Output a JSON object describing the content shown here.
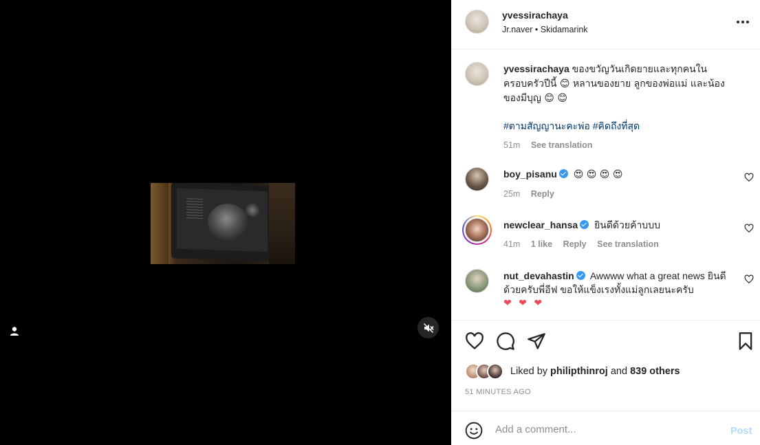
{
  "post": {
    "username": "yvessirachaya",
    "audio_line": "Jr.naver • Skidamarink",
    "caption_user": "yvessirachaya",
    "caption_text": "ของขวัญวันเกิดยายและทุกคนในครอบครัวปีนี้ 😊 หลานของยาย ลูกของพ่อแม่ และน้องของมีบุญ 😊 😊",
    "caption_tags": "#ตามสัญญานะคะพ่อ #คิดถึงที่สุด",
    "caption_time": "51m",
    "see_translation": "See translation"
  },
  "comments": [
    {
      "user": "boy_pisanu",
      "verified": true,
      "text": "😍 😍 😍 😍",
      "time": "25m",
      "likes": "",
      "reply": "Reply",
      "translate": ""
    },
    {
      "user": "newclear_hansa",
      "verified": true,
      "text": "ยินดีด้วยค้าบบบ",
      "time": "41m",
      "likes": "1 like",
      "reply": "Reply",
      "translate": "See translation"
    },
    {
      "user": "nut_devahastin",
      "verified": true,
      "text": "Awwww what a great news ยินดีด้วยครับพี่อีฟ ขอให้แข็งเรงทั้งแม่ลูกเลยนะครับ",
      "hearts": "❤ ❤ ❤",
      "time": "",
      "likes": "",
      "reply": "",
      "translate": ""
    }
  ],
  "likes": {
    "prefix": "Liked by",
    "user": "philipthinroj",
    "and": "and",
    "others": "839 others"
  },
  "timestamp": "51 MINUTES AGO",
  "add_comment": {
    "placeholder": "Add a comment...",
    "post_label": "Post"
  },
  "icons": {
    "more": "more-options-icon",
    "like": "heart-icon",
    "comment": "comment-icon",
    "share": "share-icon",
    "save": "bookmark-icon",
    "emoji": "emoji-icon",
    "mute": "muted-speaker-icon",
    "tagged": "user-tag-icon"
  },
  "colors": {
    "verified": "#3897f0",
    "tags": "#00376b",
    "post_disabled": "#b3dbff",
    "heart": "#ed4956"
  }
}
